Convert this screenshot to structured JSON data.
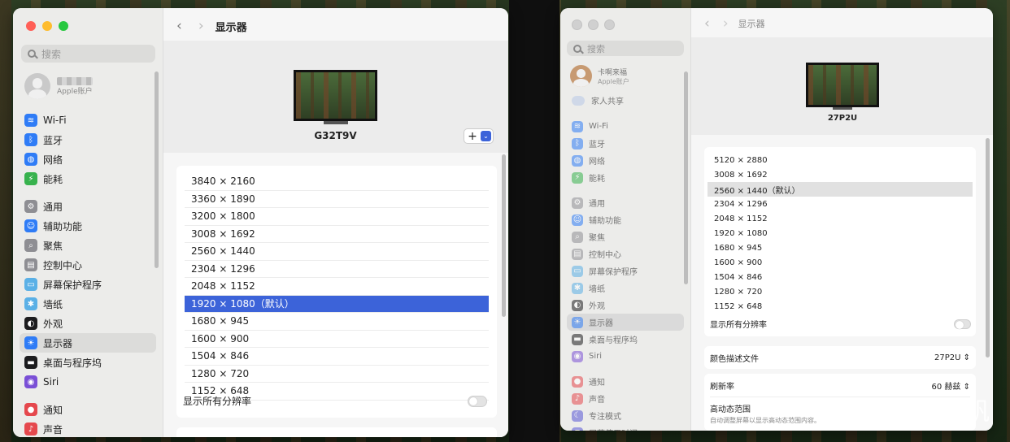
{
  "left_window": {
    "title": "显示器",
    "search_placeholder": "搜索",
    "account": {
      "name_blurred": "████",
      "sub": "Apple账户"
    },
    "sidebar": [
      {
        "label": "Wi-Fi",
        "icon": "wifi-icon",
        "color": "#2f7cf6"
      },
      {
        "label": "蓝牙",
        "icon": "bluetooth-icon",
        "color": "#2f7cf6"
      },
      {
        "label": "网络",
        "icon": "globe-icon",
        "color": "#2f7cf6"
      },
      {
        "label": "能耗",
        "icon": "battery-icon",
        "color": "#37b24d"
      },
      {
        "label": "通用",
        "icon": "gear-icon",
        "color": "#8e8e93"
      },
      {
        "label": "辅助功能",
        "icon": "accessibility-icon",
        "color": "#2f7cf6"
      },
      {
        "label": "聚焦",
        "icon": "spotlight-icon",
        "color": "#8e8e93"
      },
      {
        "label": "控制中心",
        "icon": "control-center-icon",
        "color": "#8e8e93"
      },
      {
        "label": "屏幕保护程序",
        "icon": "screensaver-icon",
        "color": "#5ab0e6"
      },
      {
        "label": "墙纸",
        "icon": "wallpaper-icon",
        "color": "#5ab0e6"
      },
      {
        "label": "外观",
        "icon": "appearance-icon",
        "color": "#1c1c1e"
      },
      {
        "label": "显示器",
        "icon": "display-icon",
        "color": "#2f7cf6"
      },
      {
        "label": "桌面与程序坞",
        "icon": "dock-icon",
        "color": "#1c1c1e"
      },
      {
        "label": "Siri",
        "icon": "siri-icon",
        "color": "#7a4fd6"
      },
      {
        "label": "通知",
        "icon": "notifications-icon",
        "color": "#e5484d"
      },
      {
        "label": "声音",
        "icon": "sound-icon",
        "color": "#e5484d"
      }
    ],
    "display_name": "G32T9V",
    "add_button": "+",
    "resolutions": [
      "3840 × 2160",
      "3360 × 1890",
      "3200 × 1800",
      "3008 × 1692",
      "2560 × 1440",
      "2304 × 1296",
      "2048 × 1152",
      "1920 × 1080（默认）",
      "1680 × 945",
      "1600 × 900",
      "1504 × 846",
      "1280 × 720",
      "1152 × 648"
    ],
    "selected_resolution": "1920 × 1080（默认）",
    "show_all_label": "显示所有分辨率"
  },
  "right_window": {
    "title": "显示器",
    "search_placeholder": "搜索",
    "account": {
      "name": "卡啊来福",
      "sub": "Apple账户"
    },
    "family": "家人共享",
    "sidebar": [
      {
        "label": "Wi-Fi",
        "icon": "wifi-icon",
        "color": "#2f7cf6"
      },
      {
        "label": "蓝牙",
        "icon": "bluetooth-icon",
        "color": "#2f7cf6"
      },
      {
        "label": "网络",
        "icon": "globe-icon",
        "color": "#2f7cf6"
      },
      {
        "label": "能耗",
        "icon": "battery-icon",
        "color": "#37b24d"
      },
      {
        "label": "通用",
        "icon": "gear-icon",
        "color": "#8e8e93"
      },
      {
        "label": "辅助功能",
        "icon": "accessibility-icon",
        "color": "#2f7cf6"
      },
      {
        "label": "聚焦",
        "icon": "spotlight-icon",
        "color": "#8e8e93"
      },
      {
        "label": "控制中心",
        "icon": "control-center-icon",
        "color": "#8e8e93"
      },
      {
        "label": "屏幕保护程序",
        "icon": "screensaver-icon",
        "color": "#5ab0e6"
      },
      {
        "label": "墙纸",
        "icon": "wallpaper-icon",
        "color": "#5ab0e6"
      },
      {
        "label": "外观",
        "icon": "appearance-icon",
        "color": "#1c1c1e"
      },
      {
        "label": "显示器",
        "icon": "display-icon",
        "color": "#2f7cf6"
      },
      {
        "label": "桌面与程序坞",
        "icon": "dock-icon",
        "color": "#1c1c1e"
      },
      {
        "label": "Siri",
        "icon": "siri-icon",
        "color": "#7a4fd6"
      },
      {
        "label": "通知",
        "icon": "notifications-icon",
        "color": "#e5484d"
      },
      {
        "label": "声音",
        "icon": "sound-icon",
        "color": "#e5484d"
      },
      {
        "label": "专注模式",
        "icon": "focus-icon",
        "color": "#5856d6"
      },
      {
        "label": "屏幕使用时间",
        "icon": "screentime-icon",
        "color": "#5856d6"
      }
    ],
    "display_name": "27P2U",
    "resolutions": [
      "5120 × 2880",
      "3008 × 1692",
      "2560 × 1440（默认）",
      "2304 × 1296",
      "2048 × 1152",
      "1920 × 1080",
      "1680 × 945",
      "1600 × 900",
      "1504 × 846",
      "1280 × 720",
      "1152 × 648"
    ],
    "selected_resolution": "2560 × 1440（默认）",
    "show_all_label": "显示所有分辨率",
    "color_profile_label": "颜色描述文件",
    "color_profile_value": "27P2U",
    "refresh_label": "刷新率",
    "refresh_value": "60 赫兹",
    "hdr_label": "高动态范围",
    "hdr_desc": "自动调整屏幕以显示高动态范围内容。"
  },
  "watermark": "@飞帆飞帆"
}
